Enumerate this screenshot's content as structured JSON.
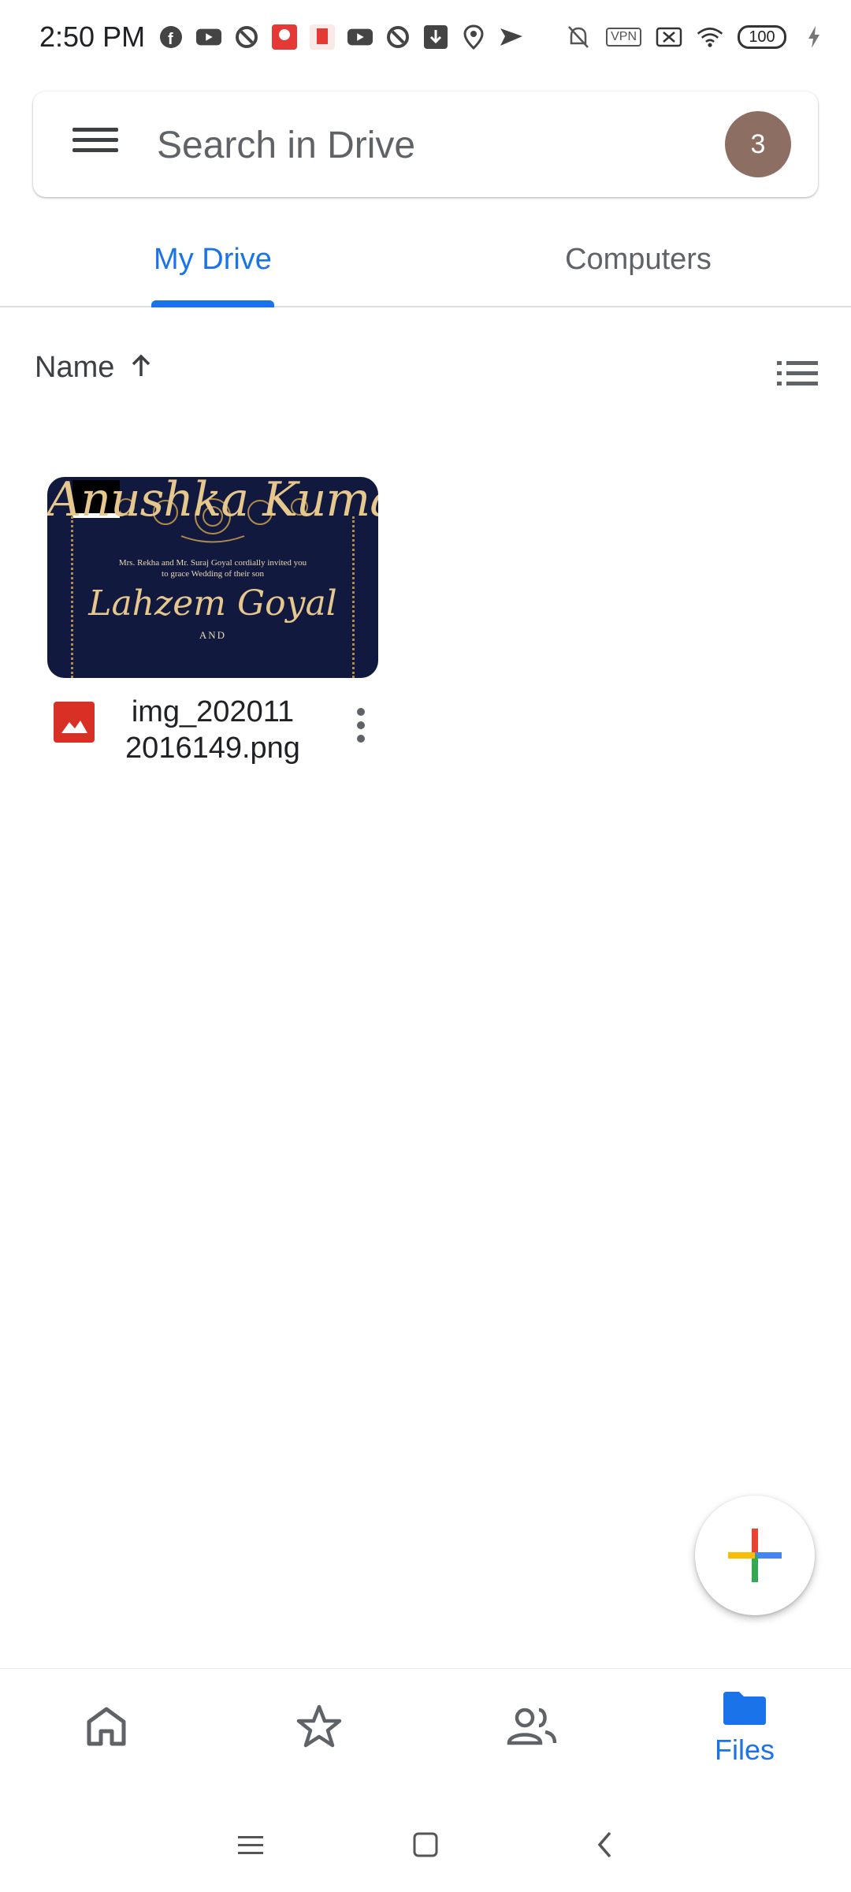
{
  "status_bar": {
    "time": "2:50 PM",
    "battery": "100",
    "vpn": "VPN",
    "left_icons": [
      "facebook-icon",
      "youtube-icon",
      "vpn-shield-icon",
      "app-icon",
      "app-icon",
      "youtube-icon",
      "vpn-shield-icon",
      "download-icon",
      "location-icon",
      "send-icon"
    ],
    "right_icons": [
      "mute-bell-icon",
      "vpn-icon",
      "no-sim-icon",
      "wifi-icon",
      "battery-icon",
      "charging-icon"
    ]
  },
  "search": {
    "placeholder": "Search in Drive",
    "avatar_letter": "3",
    "avatar_color": "#8d6e63"
  },
  "tabs": [
    {
      "label": "My Drive",
      "active": true
    },
    {
      "label": "Computers",
      "active": false
    }
  ],
  "sort": {
    "label": "Name",
    "direction_icon": "arrow-up-icon"
  },
  "files": [
    {
      "name": "img_2020112016149.png",
      "name_line1": "img_202011",
      "name_line2": "2016149.png",
      "type_icon": "image-file-icon",
      "thumbnail": {
        "title": "Anushka Kumar",
        "line1": "Mrs. Rekha and Mr. Suraj Goyal cordially invited you",
        "line2": "to grace Wedding of their son",
        "name": "Lahzem Goyal",
        "and": "AND"
      }
    }
  ],
  "bottom_nav": [
    {
      "icon": "home-icon",
      "label": ""
    },
    {
      "icon": "star-icon",
      "label": ""
    },
    {
      "icon": "shared-people-icon",
      "label": ""
    },
    {
      "icon": "folder-icon",
      "label": "Files",
      "active": true
    }
  ],
  "colors": {
    "accent": "#1a73e8",
    "text_primary": "#202124",
    "text_secondary": "#5f6368"
  }
}
